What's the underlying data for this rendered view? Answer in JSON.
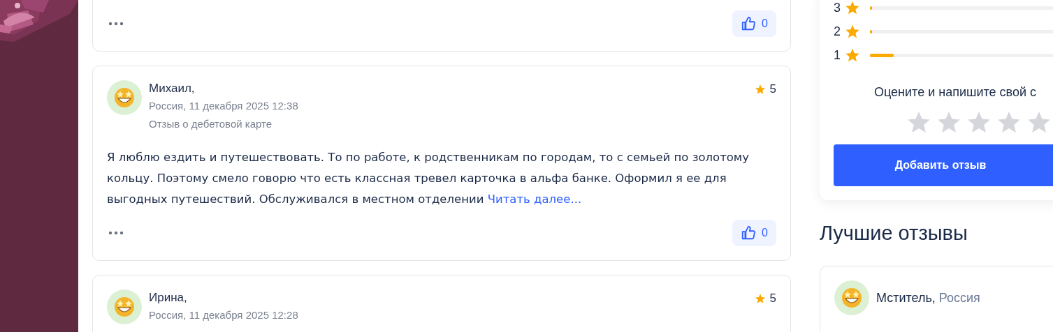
{
  "reviews": [
    {
      "likes": "0"
    },
    {
      "name": "Михаил,",
      "meta": "Россия, 11 декабря 2025 12:38",
      "type": "Отзыв о дебетовой карте",
      "rating": "5",
      "text": "Я люблю ездить и путешествовать. То по работе, к родственникам по городам, то с семьей по золотому кольцу. Поэтому смело говорю что есть классная тревел карточка в альфа банке. Оформил я ее для выгодных путешествий. Обслуживался в местном отделении",
      "read_more": "Читать далее...",
      "likes": "0"
    },
    {
      "name": "Ирина,",
      "meta": "Россия, 11 декабря 2025 12:28",
      "rating": "5"
    }
  ],
  "rating_rows": [
    {
      "label": "3",
      "level": 0.01
    },
    {
      "label": "2",
      "level": 0.01
    },
    {
      "label": "1",
      "level": 0.11
    }
  ],
  "rate_prompt": "Оцените и напишите свой с",
  "rate": {
    "stars": 0
  },
  "add_button": "Добавить отзыв",
  "best": {
    "title": "Лучшие отзывы",
    "items": [
      {
        "name": "Мститель,",
        "country": "Россия"
      }
    ]
  }
}
